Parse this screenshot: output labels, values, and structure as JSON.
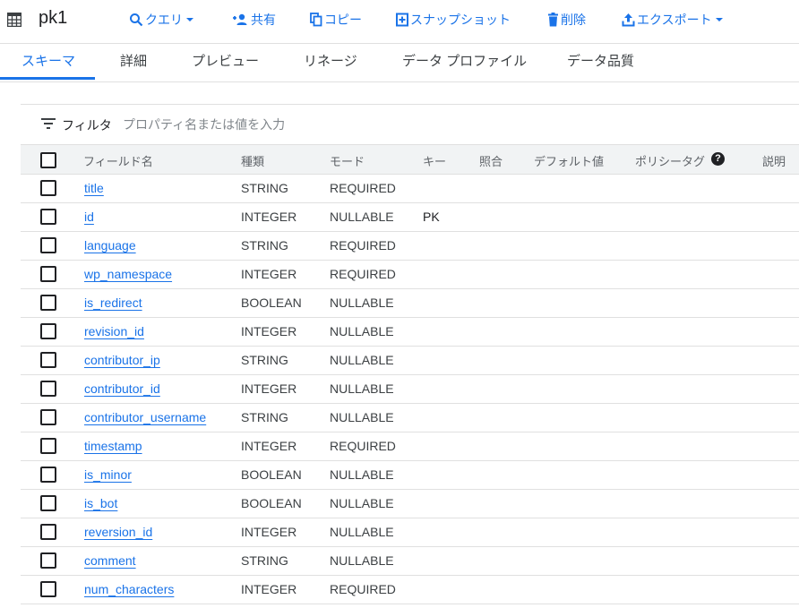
{
  "header": {
    "title": "pk1",
    "icon": "table-icon",
    "actions": [
      {
        "label": "クエリ",
        "icon": "search-icon",
        "dropdown": true
      },
      {
        "label": "共有",
        "icon": "person-add-icon"
      },
      {
        "label": "コピー",
        "icon": "copy-icon"
      },
      {
        "label": "スナップショット",
        "icon": "snapshot-icon"
      },
      {
        "label": "削除",
        "icon": "trash-icon"
      },
      {
        "label": "エクスポート",
        "icon": "export-icon",
        "dropdown": true
      }
    ]
  },
  "tabs": [
    {
      "label": "スキーマ",
      "active": true
    },
    {
      "label": "詳細"
    },
    {
      "label": "プレビュー"
    },
    {
      "label": "リネージ"
    },
    {
      "label": "データ プロファイル"
    },
    {
      "label": "データ品質"
    }
  ],
  "filter": {
    "label": "フィルタ",
    "placeholder": "プロパティ名または値を入力"
  },
  "table": {
    "columns": [
      "フィールド名",
      "種類",
      "モード",
      "キー",
      "照合",
      "デフォルト値",
      "ポリシータグ",
      "説明"
    ],
    "rows": [
      {
        "name": "title",
        "type": "STRING",
        "mode": "REQUIRED",
        "key": ""
      },
      {
        "name": "id",
        "type": "INTEGER",
        "mode": "NULLABLE",
        "key": "PK"
      },
      {
        "name": "language",
        "type": "STRING",
        "mode": "REQUIRED",
        "key": ""
      },
      {
        "name": "wp_namespace",
        "type": "INTEGER",
        "mode": "REQUIRED",
        "key": ""
      },
      {
        "name": "is_redirect",
        "type": "BOOLEAN",
        "mode": "NULLABLE",
        "key": ""
      },
      {
        "name": "revision_id",
        "type": "INTEGER",
        "mode": "NULLABLE",
        "key": ""
      },
      {
        "name": "contributor_ip",
        "type": "STRING",
        "mode": "NULLABLE",
        "key": ""
      },
      {
        "name": "contributor_id",
        "type": "INTEGER",
        "mode": "NULLABLE",
        "key": ""
      },
      {
        "name": "contributor_username",
        "type": "STRING",
        "mode": "NULLABLE",
        "key": ""
      },
      {
        "name": "timestamp",
        "type": "INTEGER",
        "mode": "REQUIRED",
        "key": ""
      },
      {
        "name": "is_minor",
        "type": "BOOLEAN",
        "mode": "NULLABLE",
        "key": ""
      },
      {
        "name": "is_bot",
        "type": "BOOLEAN",
        "mode": "NULLABLE",
        "key": ""
      },
      {
        "name": "reversion_id",
        "type": "INTEGER",
        "mode": "NULLABLE",
        "key": ""
      },
      {
        "name": "comment",
        "type": "STRING",
        "mode": "NULLABLE",
        "key": ""
      },
      {
        "name": "num_characters",
        "type": "INTEGER",
        "mode": "REQUIRED",
        "key": ""
      }
    ]
  },
  "colors": {
    "accent": "#1a73e8",
    "header_bg": "#f1f3f4",
    "divider": "#e0e0e0"
  }
}
